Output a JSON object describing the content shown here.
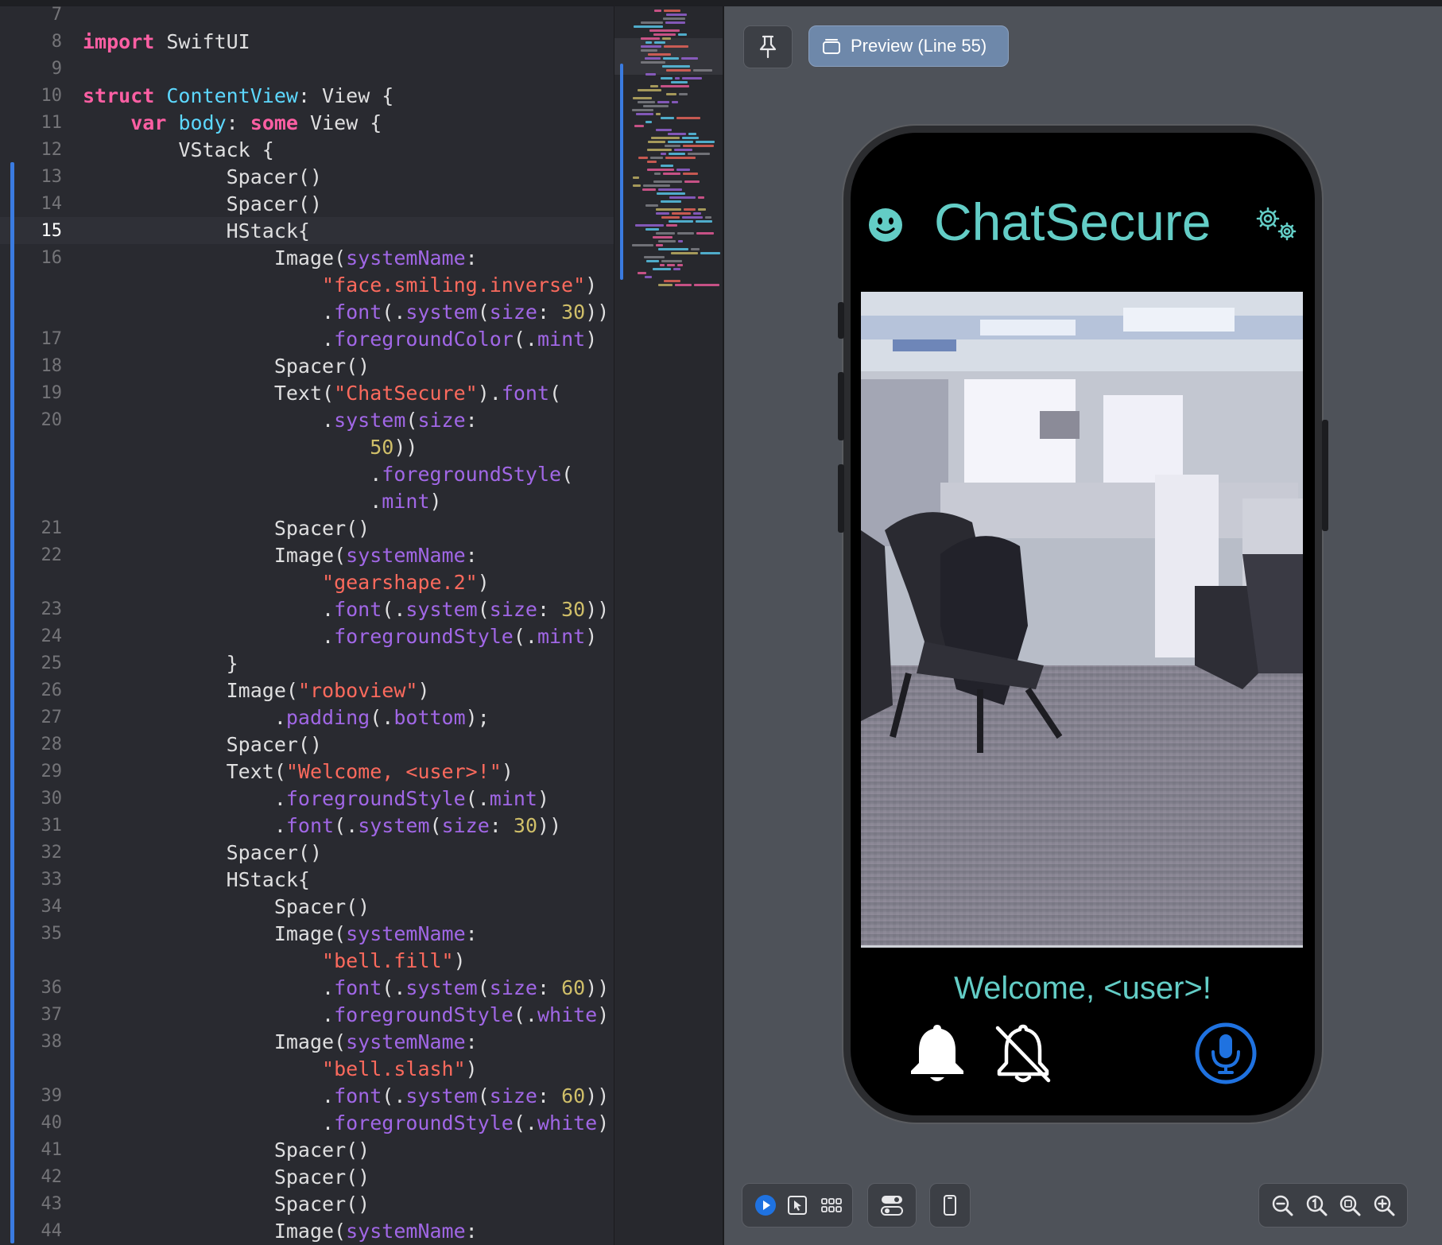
{
  "editor": {
    "lines": [
      {
        "num": "7",
        "parts": []
      },
      {
        "num": "8",
        "parts": [
          {
            "c": "kw",
            "t": "import"
          },
          {
            "c": "pl",
            "t": " SwiftUI"
          }
        ]
      },
      {
        "num": "9",
        "parts": []
      },
      {
        "num": "10",
        "parts": [
          {
            "c": "kw",
            "t": "struct"
          },
          {
            "c": "pl",
            "t": " "
          },
          {
            "c": "tn",
            "t": "ContentView"
          },
          {
            "c": "pl",
            "t": ": View {"
          }
        ]
      },
      {
        "num": "11",
        "parts": [
          {
            "c": "pl",
            "t": "    "
          },
          {
            "c": "kw",
            "t": "var"
          },
          {
            "c": "pl",
            "t": " "
          },
          {
            "c": "tn",
            "t": "body"
          },
          {
            "c": "pl",
            "t": ": "
          },
          {
            "c": "kw",
            "t": "some"
          },
          {
            "c": "pl",
            "t": " View {"
          }
        ]
      },
      {
        "num": "12",
        "parts": [
          {
            "c": "pl",
            "t": "        VStack {"
          }
        ]
      },
      {
        "num": "13",
        "parts": [
          {
            "c": "pl",
            "t": "            Spacer()"
          }
        ]
      },
      {
        "num": "14",
        "parts": [
          {
            "c": "pl",
            "t": "            Spacer()"
          }
        ]
      },
      {
        "num": "15",
        "parts": [
          {
            "c": "pl",
            "t": "            HStack{"
          }
        ]
      },
      {
        "num": "16",
        "parts": [
          {
            "c": "pl",
            "t": "                Image("
          },
          {
            "c": "pr",
            "t": "systemName"
          },
          {
            "c": "pl",
            "t": ":"
          }
        ]
      },
      {
        "num": "",
        "parts": [
          {
            "c": "pl",
            "t": "                    "
          },
          {
            "c": "st",
            "t": "\"face.smiling.inverse\""
          },
          {
            "c": "pl",
            "t": ")"
          }
        ]
      },
      {
        "num": "",
        "parts": [
          {
            "c": "pl",
            "t": "                    ."
          },
          {
            "c": "pr",
            "t": "font"
          },
          {
            "c": "pl",
            "t": "(."
          },
          {
            "c": "pr",
            "t": "system"
          },
          {
            "c": "pl",
            "t": "("
          },
          {
            "c": "pr",
            "t": "size"
          },
          {
            "c": "pl",
            "t": ": "
          },
          {
            "c": "nu",
            "t": "30"
          },
          {
            "c": "pl",
            "t": "))"
          }
        ]
      },
      {
        "num": "17",
        "parts": [
          {
            "c": "pl",
            "t": "                    ."
          },
          {
            "c": "pr",
            "t": "foregroundColor"
          },
          {
            "c": "pl",
            "t": "(."
          },
          {
            "c": "pr",
            "t": "mint"
          },
          {
            "c": "pl",
            "t": ")"
          }
        ]
      },
      {
        "num": "18",
        "parts": [
          {
            "c": "pl",
            "t": "                Spacer()"
          }
        ]
      },
      {
        "num": "19",
        "parts": [
          {
            "c": "pl",
            "t": "                Text("
          },
          {
            "c": "st",
            "t": "\"ChatSecure\""
          },
          {
            "c": "pl",
            "t": ")."
          },
          {
            "c": "pr",
            "t": "font"
          },
          {
            "c": "pl",
            "t": "("
          }
        ]
      },
      {
        "num": "20",
        "parts": [
          {
            "c": "pl",
            "t": "                    ."
          },
          {
            "c": "pr",
            "t": "system"
          },
          {
            "c": "pl",
            "t": "("
          },
          {
            "c": "pr",
            "t": "size"
          },
          {
            "c": "pl",
            "t": ":"
          }
        ]
      },
      {
        "num": "",
        "parts": [
          {
            "c": "pl",
            "t": "                        "
          },
          {
            "c": "nu",
            "t": "50"
          },
          {
            "c": "pl",
            "t": "))"
          }
        ]
      },
      {
        "num": "",
        "parts": [
          {
            "c": "pl",
            "t": "                        ."
          },
          {
            "c": "pr",
            "t": "foregroundStyle"
          },
          {
            "c": "pl",
            "t": "("
          }
        ]
      },
      {
        "num": "",
        "parts": [
          {
            "c": "pl",
            "t": "                        ."
          },
          {
            "c": "pr",
            "t": "mint"
          },
          {
            "c": "pl",
            "t": ")"
          }
        ]
      },
      {
        "num": "21",
        "parts": [
          {
            "c": "pl",
            "t": "                Spacer()"
          }
        ]
      },
      {
        "num": "22",
        "parts": [
          {
            "c": "pl",
            "t": "                Image("
          },
          {
            "c": "pr",
            "t": "systemName"
          },
          {
            "c": "pl",
            "t": ":"
          }
        ]
      },
      {
        "num": "",
        "parts": [
          {
            "c": "pl",
            "t": "                    "
          },
          {
            "c": "st",
            "t": "\"gearshape.2\""
          },
          {
            "c": "pl",
            "t": ")"
          }
        ]
      },
      {
        "num": "23",
        "parts": [
          {
            "c": "pl",
            "t": "                    ."
          },
          {
            "c": "pr",
            "t": "font"
          },
          {
            "c": "pl",
            "t": "(."
          },
          {
            "c": "pr",
            "t": "system"
          },
          {
            "c": "pl",
            "t": "("
          },
          {
            "c": "pr",
            "t": "size"
          },
          {
            "c": "pl",
            "t": ": "
          },
          {
            "c": "nu",
            "t": "30"
          },
          {
            "c": "pl",
            "t": "))"
          }
        ]
      },
      {
        "num": "24",
        "parts": [
          {
            "c": "pl",
            "t": "                    ."
          },
          {
            "c": "pr",
            "t": "foregroundStyle"
          },
          {
            "c": "pl",
            "t": "(."
          },
          {
            "c": "pr",
            "t": "mint"
          },
          {
            "c": "pl",
            "t": ")"
          }
        ]
      },
      {
        "num": "25",
        "parts": [
          {
            "c": "pl",
            "t": "            }"
          }
        ]
      },
      {
        "num": "26",
        "parts": [
          {
            "c": "pl",
            "t": "            Image("
          },
          {
            "c": "st",
            "t": "\"roboview\""
          },
          {
            "c": "pl",
            "t": ")"
          }
        ]
      },
      {
        "num": "27",
        "parts": [
          {
            "c": "pl",
            "t": "                ."
          },
          {
            "c": "pr",
            "t": "padding"
          },
          {
            "c": "pl",
            "t": "(."
          },
          {
            "c": "pr",
            "t": "bottom"
          },
          {
            "c": "pl",
            "t": ");"
          }
        ]
      },
      {
        "num": "28",
        "parts": [
          {
            "c": "pl",
            "t": "            Spacer()"
          }
        ]
      },
      {
        "num": "29",
        "parts": [
          {
            "c": "pl",
            "t": "            Text("
          },
          {
            "c": "st",
            "t": "\"Welcome, <user>!\""
          },
          {
            "c": "pl",
            "t": ")"
          }
        ]
      },
      {
        "num": "30",
        "parts": [
          {
            "c": "pl",
            "t": "                ."
          },
          {
            "c": "pr",
            "t": "foregroundStyle"
          },
          {
            "c": "pl",
            "t": "(."
          },
          {
            "c": "pr",
            "t": "mint"
          },
          {
            "c": "pl",
            "t": ")"
          }
        ]
      },
      {
        "num": "31",
        "parts": [
          {
            "c": "pl",
            "t": "                ."
          },
          {
            "c": "pr",
            "t": "font"
          },
          {
            "c": "pl",
            "t": "(."
          },
          {
            "c": "pr",
            "t": "system"
          },
          {
            "c": "pl",
            "t": "("
          },
          {
            "c": "pr",
            "t": "size"
          },
          {
            "c": "pl",
            "t": ": "
          },
          {
            "c": "nu",
            "t": "30"
          },
          {
            "c": "pl",
            "t": "))"
          }
        ]
      },
      {
        "num": "32",
        "parts": [
          {
            "c": "pl",
            "t": "            Spacer()"
          }
        ]
      },
      {
        "num": "33",
        "parts": [
          {
            "c": "pl",
            "t": "            HStack{"
          }
        ]
      },
      {
        "num": "34",
        "parts": [
          {
            "c": "pl",
            "t": "                Spacer()"
          }
        ]
      },
      {
        "num": "35",
        "parts": [
          {
            "c": "pl",
            "t": "                Image("
          },
          {
            "c": "pr",
            "t": "systemName"
          },
          {
            "c": "pl",
            "t": ":"
          }
        ]
      },
      {
        "num": "",
        "parts": [
          {
            "c": "pl",
            "t": "                    "
          },
          {
            "c": "st",
            "t": "\"bell.fill\""
          },
          {
            "c": "pl",
            "t": ")"
          }
        ]
      },
      {
        "num": "36",
        "parts": [
          {
            "c": "pl",
            "t": "                    ."
          },
          {
            "c": "pr",
            "t": "font"
          },
          {
            "c": "pl",
            "t": "(."
          },
          {
            "c": "pr",
            "t": "system"
          },
          {
            "c": "pl",
            "t": "("
          },
          {
            "c": "pr",
            "t": "size"
          },
          {
            "c": "pl",
            "t": ": "
          },
          {
            "c": "nu",
            "t": "60"
          },
          {
            "c": "pl",
            "t": "))"
          }
        ]
      },
      {
        "num": "37",
        "parts": [
          {
            "c": "pl",
            "t": "                    ."
          },
          {
            "c": "pr",
            "t": "foregroundStyle"
          },
          {
            "c": "pl",
            "t": "(."
          },
          {
            "c": "pr",
            "t": "white"
          },
          {
            "c": "pl",
            "t": ")"
          }
        ]
      },
      {
        "num": "38",
        "parts": [
          {
            "c": "pl",
            "t": "                Image("
          },
          {
            "c": "pr",
            "t": "systemName"
          },
          {
            "c": "pl",
            "t": ":"
          }
        ]
      },
      {
        "num": "",
        "parts": [
          {
            "c": "pl",
            "t": "                    "
          },
          {
            "c": "st",
            "t": "\"bell.slash\""
          },
          {
            "c": "pl",
            "t": ")"
          }
        ]
      },
      {
        "num": "39",
        "parts": [
          {
            "c": "pl",
            "t": "                    ."
          },
          {
            "c": "pr",
            "t": "font"
          },
          {
            "c": "pl",
            "t": "(."
          },
          {
            "c": "pr",
            "t": "system"
          },
          {
            "c": "pl",
            "t": "("
          },
          {
            "c": "pr",
            "t": "size"
          },
          {
            "c": "pl",
            "t": ": "
          },
          {
            "c": "nu",
            "t": "60"
          },
          {
            "c": "pl",
            "t": "))"
          }
        ]
      },
      {
        "num": "40",
        "parts": [
          {
            "c": "pl",
            "t": "                    ."
          },
          {
            "c": "pr",
            "t": "foregroundStyle"
          },
          {
            "c": "pl",
            "t": "(."
          },
          {
            "c": "pr",
            "t": "white"
          },
          {
            "c": "pl",
            "t": ")"
          }
        ]
      },
      {
        "num": "41",
        "parts": [
          {
            "c": "pl",
            "t": "                Spacer()"
          }
        ]
      },
      {
        "num": "42",
        "parts": [
          {
            "c": "pl",
            "t": "                Spacer()"
          }
        ]
      },
      {
        "num": "43",
        "parts": [
          {
            "c": "pl",
            "t": "                Spacer()"
          }
        ]
      },
      {
        "num": "44",
        "parts": [
          {
            "c": "pl",
            "t": "                Image("
          },
          {
            "c": "pr",
            "t": "systemName"
          },
          {
            "c": "pl",
            "t": ":"
          }
        ]
      }
    ],
    "current_line": "15"
  },
  "canvas": {
    "pin_icon": "pin-icon",
    "preview_label": "Preview (Line 55)",
    "preview_icon": "preview-stack-icon"
  },
  "app": {
    "title": "ChatSecure",
    "welcome": "Welcome, <user>!",
    "mint_color": "#63cdc6",
    "mic_color": "#1f72e0",
    "icons": [
      "face-smiling-inverse-icon",
      "gearshape-2-icon",
      "bell-fill-icon",
      "bell-slash-icon",
      "mic-circle-icon"
    ]
  },
  "toolbar": {
    "icons": [
      "play-icon",
      "select-pointer-icon",
      "grid-icon",
      "variants-toggle-icon",
      "device-icon",
      "zoom-out-icon",
      "zoom-actual-icon",
      "zoom-fit-icon",
      "zoom-in-icon"
    ]
  },
  "colors": {
    "editor_bg": "#292a30",
    "canvas_bg": "#4e5259",
    "keyword": "#fc5fa3",
    "string": "#fc6a5d",
    "number": "#d0bf69",
    "property": "#a167e6",
    "type_decl": "#5dd8ff"
  }
}
